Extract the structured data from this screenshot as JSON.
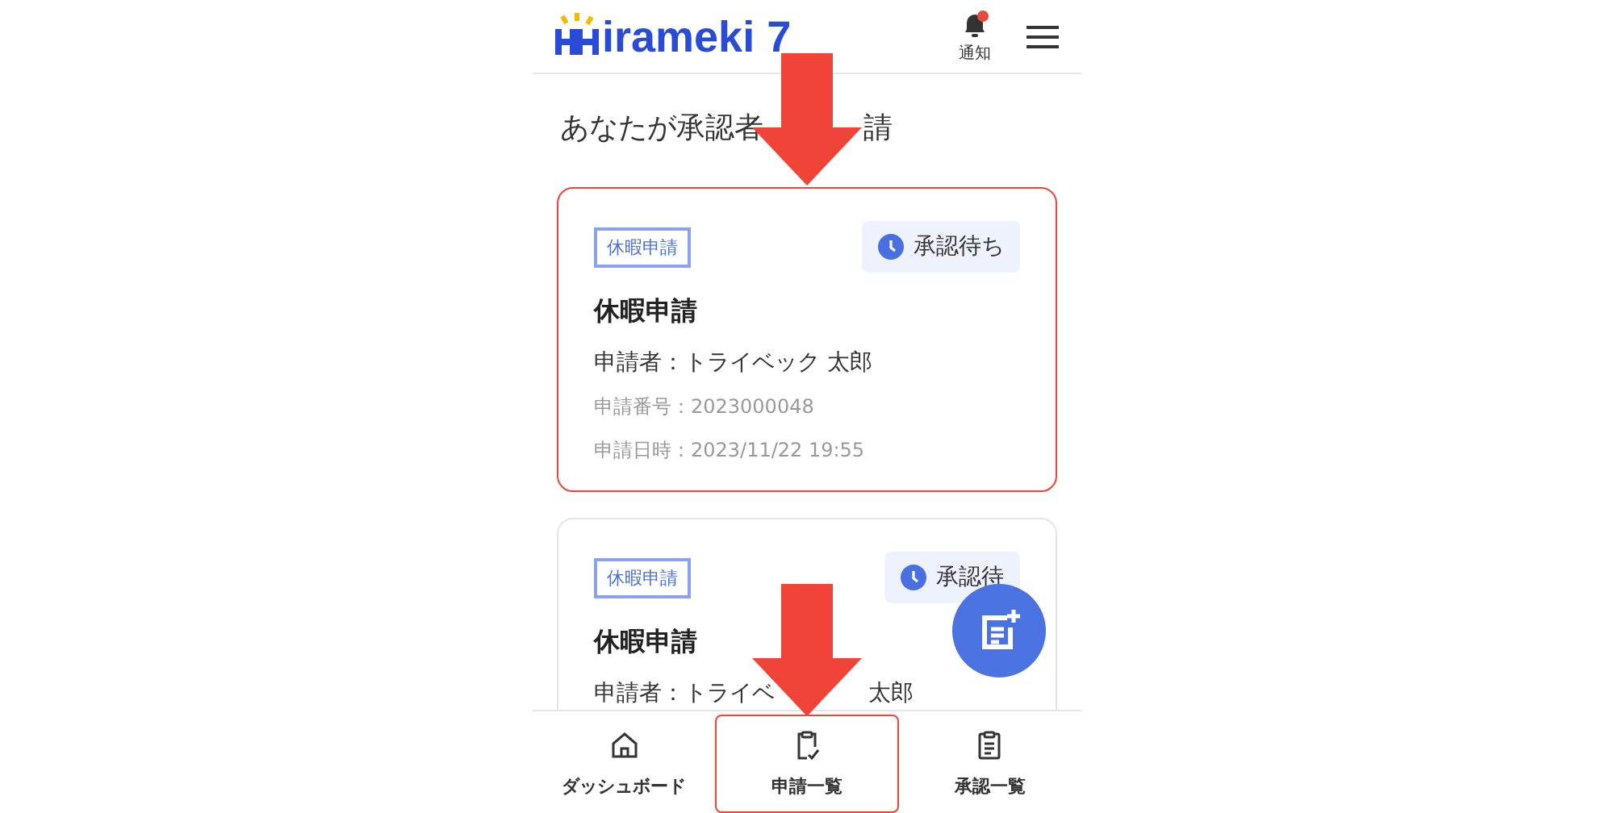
{
  "header": {
    "logo": "irameki 7",
    "notification": {
      "label": "通知",
      "unread": true
    }
  },
  "heading": [
    "あなたが承認者",
    "請"
  ],
  "cards": [
    {
      "tag": "休暇申請",
      "status": "承認待ち",
      "title": "休暇申請",
      "applicant": [
        "申請者：トライベック 太郎"
      ],
      "number": "申請番号：2023000048",
      "date": "申請日時：2023/11/22 19:55",
      "highlighted": true
    },
    {
      "tag": "休暇申請",
      "status": "承認待",
      "title": "休暇申請",
      "applicant": [
        "申請者：トライベ",
        "太郎"
      ],
      "highlighted": false
    }
  ],
  "nav": [
    {
      "label": "ダッシュボード",
      "kind": "home",
      "selected": false
    },
    {
      "label": "申請一覧",
      "kind": "check",
      "selected": true
    },
    {
      "label": "承認一覧",
      "kind": "list",
      "selected": false
    }
  ]
}
